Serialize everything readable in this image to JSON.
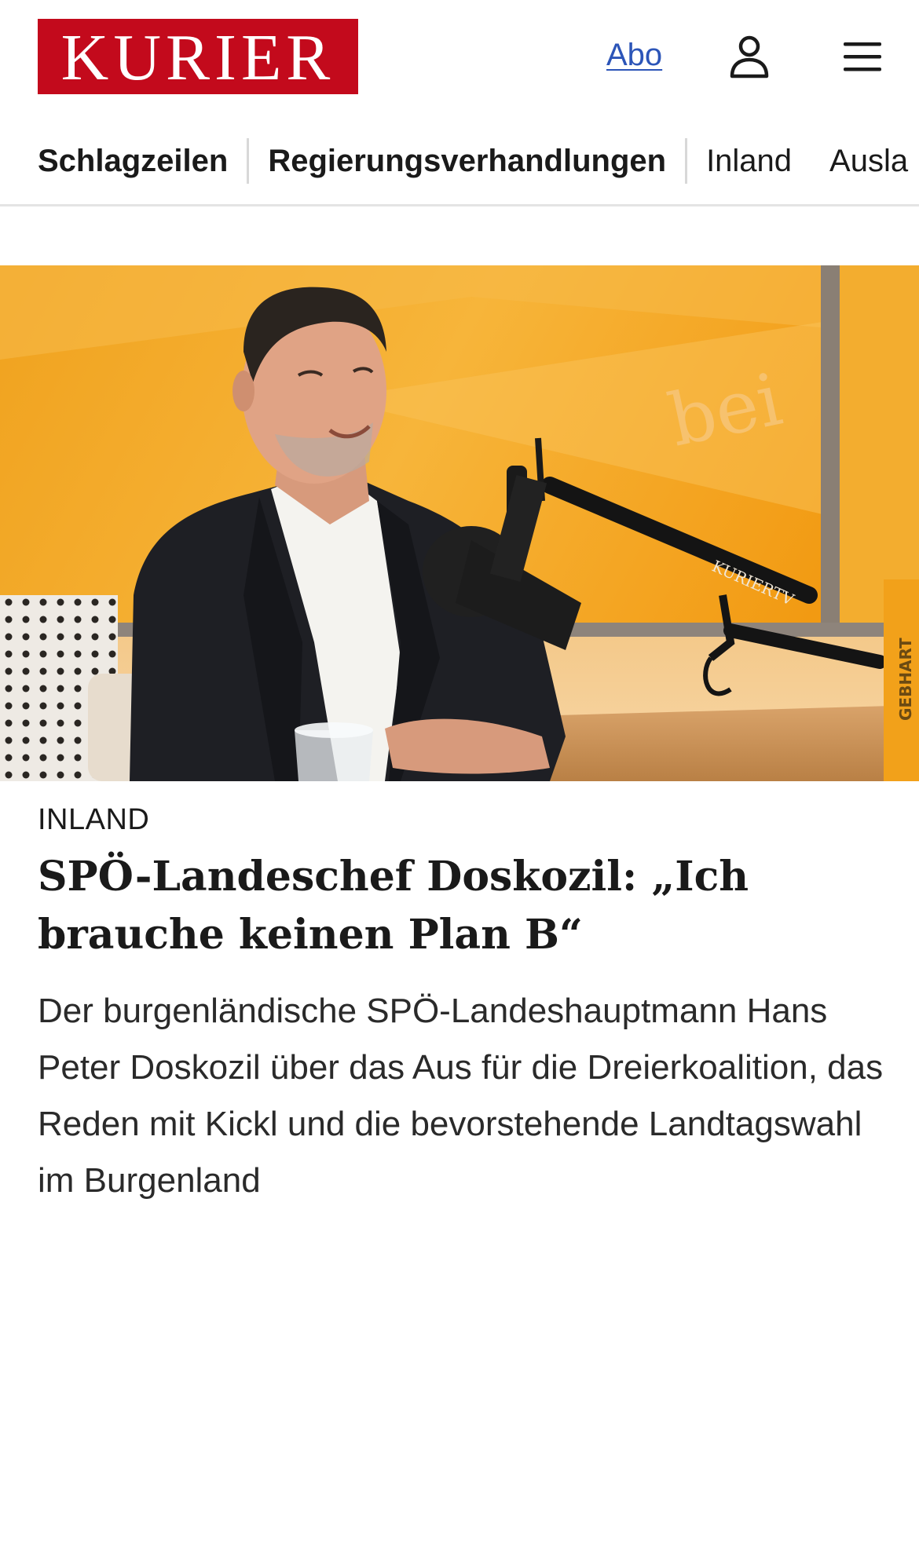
{
  "brand": {
    "logo_text": "KURIER",
    "color": "#c30a1c"
  },
  "header": {
    "abo_label": "Abo",
    "user_icon": "user-icon",
    "menu_icon": "hamburger-menu-icon"
  },
  "nav": {
    "items": [
      {
        "label": "Schlagzeilen"
      },
      {
        "label": "Regierungsverhandlungen"
      },
      {
        "label": "Inland"
      },
      {
        "label": "Ausla"
      }
    ]
  },
  "article": {
    "image_watermark": "bei",
    "mic_label": "KURIERTV",
    "book_label": "GEBHART",
    "kicker": "INLAND",
    "headline": "SPÖ-Landeschef Doskozil: „Ich brauche keinen Plan B“",
    "teaser": "Der burgenländische SPÖ-Landeshauptmann Hans Peter Doskozil über das Aus für die Dreierkoalition, das Reden mit Kickl und die bevorstehende Landtagswahl im Burgenland"
  },
  "colors": {
    "link": "#2c55b8",
    "divider": "#e4e4e4",
    "studio_orange": "#f5a623"
  }
}
